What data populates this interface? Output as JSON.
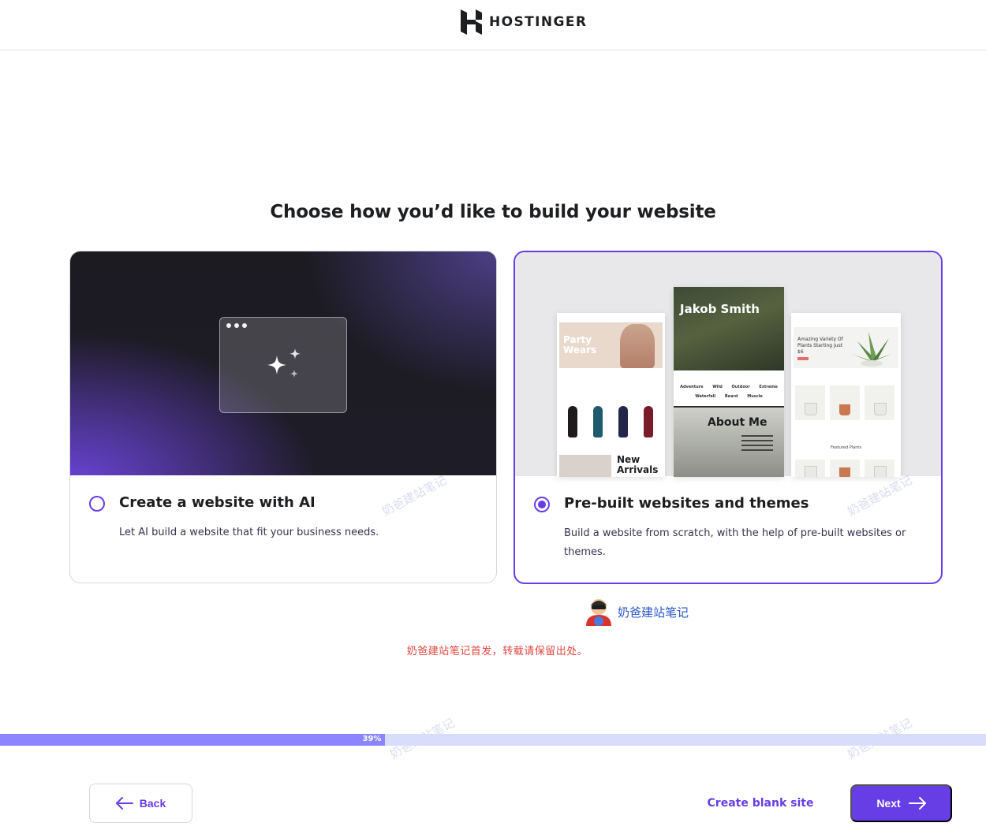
{
  "header": {
    "brand": "HOSTINGER",
    "logo_icon": "hostinger-logo-icon"
  },
  "page": {
    "title": "Choose how you’d like to build your website"
  },
  "options": [
    {
      "id": "ai",
      "title": "Create a website with AI",
      "description": "Let AI build a website that fit your business needs.",
      "selected": false,
      "media_icon": "sparkles-icon"
    },
    {
      "id": "prebuilt",
      "title": "Pre-built websites and themes",
      "description": "Build a website from scratch, with the help of pre-built websites or themes.",
      "selected": true,
      "previews": {
        "fashion": {
          "hero": "Party Wears",
          "section": "New Arrivals"
        },
        "portfolio": {
          "name": "Jakob Smith",
          "tags_row1": "Adventure Wild Outdoor Extreme",
          "tags_row2": "Waterfall Beard Muscle",
          "section": "About Me"
        },
        "plants": {
          "hero": "Amazing Variety Of Plants Starting Just $6",
          "section": "Featured Plants"
        }
      }
    }
  ],
  "watermark": {
    "author": "奶爸建站笔记",
    "note": "奶爸建站笔记首发，转载请保留出处。"
  },
  "progress": {
    "percent": 39,
    "label": "39%"
  },
  "footer": {
    "back_label": "Back",
    "blank_label": "Create blank site",
    "next_label": "Next"
  },
  "colors": {
    "accent": "#673de6",
    "progress_fill": "#8c85ff",
    "progress_track": "#d8ddfb",
    "watermark_note": "#e0463f"
  }
}
